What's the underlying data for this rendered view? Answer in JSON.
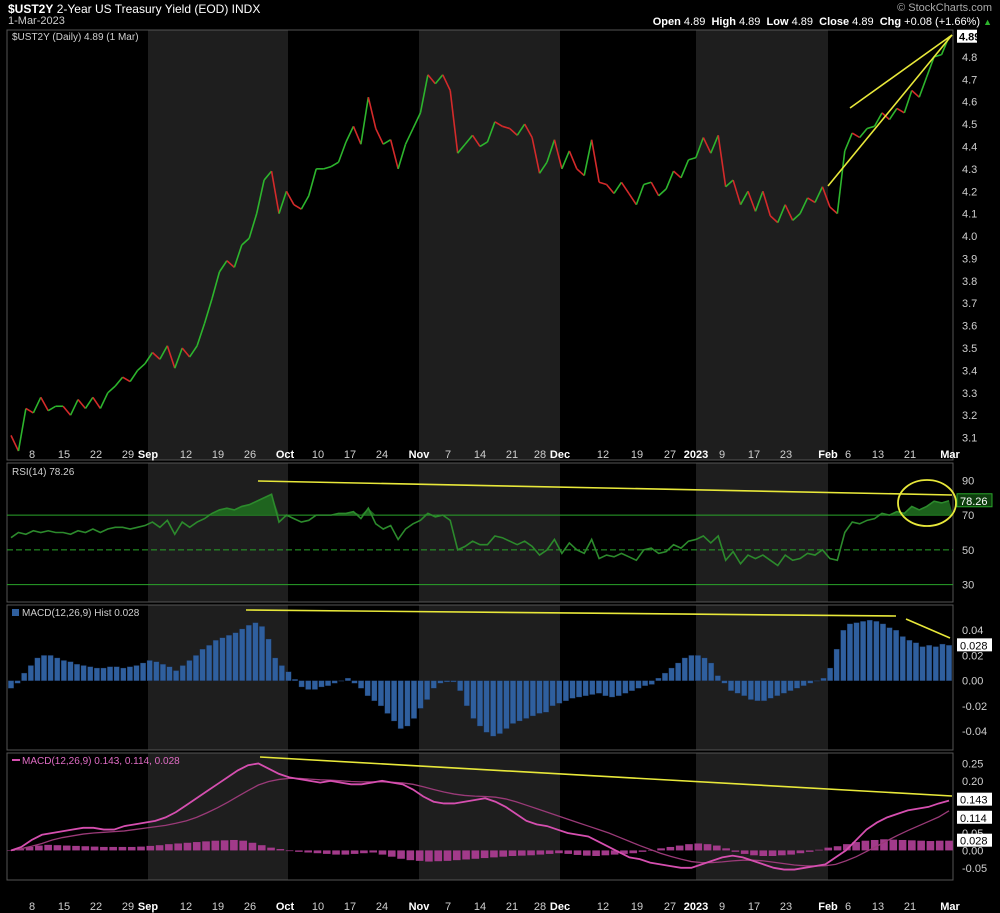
{
  "header": {
    "symbol": "$UST2Y",
    "name": "2-Year US Treasury Yield (EOD)",
    "exchange": "INDX",
    "date": "1-Mar-2023",
    "brand": "© StockCharts.com",
    "open_label": "Open",
    "open": "4.89",
    "high_label": "High",
    "high": "4.89",
    "low_label": "Low",
    "low": "4.89",
    "close_label": "Close",
    "close": "4.89",
    "chg_label": "Chg",
    "chg": "+0.08 (+1.66%)"
  },
  "colors": {
    "up": "#2db52d",
    "down": "#d42a2a",
    "band_dark": "#000000",
    "band_light": "#1e1e1e",
    "annotation": "#e8e83a",
    "rsi_line": "#2c8a2c",
    "rsi_fill": "#1f6b1f",
    "macd_hist": "#2f5f9e",
    "macd_line": "#d64fb0",
    "macd_signal": "#9a3a78",
    "macd_hist2": "#a23a8a"
  },
  "x_axis": {
    "labels": [
      "8",
      "15",
      "22",
      "29",
      "Sep",
      "12",
      "19",
      "26",
      "Oct",
      "10",
      "17",
      "24",
      "Nov",
      "7",
      "14",
      "21",
      "28",
      "Dec",
      "12",
      "19",
      "27",
      "2023",
      "9",
      "17",
      "23",
      "Feb",
      "6",
      "13",
      "21",
      "Mar"
    ],
    "bold": [
      "Sep",
      "Oct",
      "Nov",
      "Dec",
      "2023",
      "Feb",
      "Mar"
    ]
  },
  "chart_data": [
    {
      "type": "line",
      "title": "$UST2Y (Daily) 4.89 (1 Mar)",
      "y_ticks": [
        "3.1",
        "3.2",
        "3.3",
        "3.4",
        "3.5",
        "3.6",
        "3.7",
        "3.8",
        "3.9",
        "4.0",
        "4.1",
        "4.2",
        "4.3",
        "4.4",
        "4.5",
        "4.6",
        "4.7",
        "4.8"
      ],
      "ylim": [
        3.0,
        4.92
      ],
      "last_label": "4.89",
      "values": [
        3.11,
        3.04,
        3.23,
        3.21,
        3.28,
        3.22,
        3.24,
        3.24,
        3.2,
        3.27,
        3.23,
        3.28,
        3.23,
        3.3,
        3.33,
        3.37,
        3.35,
        3.4,
        3.43,
        3.48,
        3.45,
        3.51,
        3.41,
        3.5,
        3.46,
        3.51,
        3.61,
        3.72,
        3.84,
        3.89,
        3.86,
        3.96,
        3.99,
        4.1,
        4.25,
        4.29,
        4.1,
        4.2,
        4.14,
        4.12,
        4.18,
        4.3,
        4.3,
        4.31,
        4.33,
        4.42,
        4.49,
        4.41,
        4.62,
        4.48,
        4.41,
        4.43,
        4.3,
        4.41,
        4.48,
        4.55,
        4.72,
        4.68,
        4.72,
        4.65,
        4.37,
        4.41,
        4.45,
        4.4,
        4.42,
        4.51,
        4.49,
        4.48,
        4.45,
        4.5,
        4.44,
        4.28,
        4.33,
        4.43,
        4.3,
        4.38,
        4.3,
        4.27,
        4.43,
        4.24,
        4.23,
        4.19,
        4.24,
        4.19,
        4.14,
        4.23,
        4.24,
        4.18,
        4.21,
        4.29,
        4.26,
        4.34,
        4.35,
        4.44,
        4.37,
        4.45,
        4.22,
        4.25,
        4.14,
        4.2,
        4.11,
        4.2,
        4.09,
        4.06,
        4.14,
        4.07,
        4.1,
        4.17,
        4.15,
        4.22,
        4.13,
        4.1,
        4.38,
        4.46,
        4.44,
        4.48,
        4.49,
        4.55,
        4.52,
        4.57,
        4.55,
        4.65,
        4.62,
        4.71,
        4.8,
        4.81,
        4.89
      ]
    },
    {
      "type": "line",
      "title": "RSI(14) 78.26",
      "y_ticks": [
        "30",
        "50",
        "70",
        "90"
      ],
      "ylim": [
        20,
        100
      ],
      "last_label": "78.26",
      "values": [
        57,
        60,
        59,
        61,
        60,
        61,
        60,
        60,
        59,
        61,
        60,
        62,
        60,
        62,
        63,
        63,
        62,
        63,
        64,
        66,
        63,
        67,
        59,
        66,
        63,
        66,
        68,
        71,
        73,
        74,
        73,
        75,
        76,
        78,
        80,
        82,
        66,
        70,
        68,
        66,
        67,
        70,
        70,
        70,
        71,
        71,
        72,
        68,
        74,
        65,
        62,
        64,
        56,
        62,
        65,
        67,
        71,
        69,
        70,
        67,
        50,
        52,
        55,
        53,
        53,
        58,
        57,
        55,
        53,
        55,
        52,
        47,
        50,
        56,
        48,
        54,
        50,
        48,
        56,
        45,
        47,
        46,
        48,
        46,
        44,
        50,
        51,
        48,
        49,
        53,
        51,
        55,
        56,
        58,
        54,
        58,
        44,
        49,
        42,
        47,
        45,
        47,
        44,
        41,
        47,
        44,
        45,
        48,
        47,
        50,
        45,
        44,
        60,
        66,
        65,
        67,
        68,
        71,
        70,
        72,
        71,
        75,
        73,
        75,
        78,
        77,
        78.26
      ]
    },
    {
      "type": "bar",
      "title": "MACD(12,26,9) Hist 0.028",
      "y_ticks": [
        "-0.04",
        "-0.02",
        "0.00",
        "0.02",
        "0.04"
      ],
      "ylim": [
        -0.055,
        0.06
      ],
      "last_label": "0.028",
      "values": [
        -0.006,
        -0.002,
        0.006,
        0.012,
        0.018,
        0.02,
        0.02,
        0.018,
        0.016,
        0.015,
        0.013,
        0.012,
        0.011,
        0.01,
        0.01,
        0.011,
        0.011,
        0.01,
        0.011,
        0.012,
        0.014,
        0.016,
        0.015,
        0.013,
        0.011,
        0.008,
        0.012,
        0.016,
        0.02,
        0.025,
        0.028,
        0.032,
        0.034,
        0.036,
        0.038,
        0.041,
        0.044,
        0.046,
        0.043,
        0.033,
        0.018,
        0.012,
        0.007,
        0.001,
        -0.005,
        -0.007,
        -0.007,
        -0.005,
        -0.004,
        -0.002,
        0.0,
        0.002,
        -0.002,
        -0.006,
        -0.012,
        -0.016,
        -0.02,
        -0.026,
        -0.032,
        -0.038,
        -0.036,
        -0.03,
        -0.022,
        -0.015,
        -0.006,
        -0.002,
        -0.001,
        -0.001,
        -0.008,
        -0.02,
        -0.03,
        -0.036,
        -0.041,
        -0.044,
        -0.042,
        -0.038,
        -0.034,
        -0.032,
        -0.03,
        -0.028,
        -0.026,
        -0.025,
        -0.02,
        -0.018,
        -0.016,
        -0.014,
        -0.013,
        -0.012,
        -0.011,
        -0.01,
        -0.012,
        -0.013,
        -0.012,
        -0.01,
        -0.008,
        -0.006,
        -0.004,
        -0.003,
        0.002,
        0.006,
        0.01,
        0.014,
        0.018,
        0.02,
        0.02,
        0.018,
        0.014,
        0.004,
        -0.002,
        -0.008,
        -0.01,
        -0.012,
        -0.015,
        -0.016,
        -0.016,
        -0.014,
        -0.012,
        -0.01,
        -0.008,
        -0.006,
        -0.004,
        -0.002,
        0.0,
        0.002,
        0.01,
        0.025,
        0.04,
        0.045,
        0.046,
        0.047,
        0.048,
        0.047,
        0.045,
        0.042,
        0.04,
        0.035,
        0.032,
        0.03,
        0.027,
        0.028,
        0.027,
        0.029,
        0.028
      ]
    },
    {
      "type": "line",
      "title": "MACD(12,26,9) 0.143, 0.114, 0.028",
      "y_ticks": [
        "-0.05",
        "0.00",
        "0.05",
        "0.10",
        "0.15",
        "0.20",
        "0.25"
      ],
      "ylim": [
        -0.085,
        0.28
      ],
      "last_labels": [
        "0.143",
        "0.114",
        "0.028"
      ],
      "macd": [
        0.0,
        0.01,
        0.03,
        0.045,
        0.05,
        0.055,
        0.06,
        0.065,
        0.065,
        0.06,
        0.06,
        0.07,
        0.075,
        0.08,
        0.085,
        0.095,
        0.11,
        0.13,
        0.15,
        0.17,
        0.19,
        0.21,
        0.23,
        0.245,
        0.25,
        0.235,
        0.22,
        0.21,
        0.205,
        0.2,
        0.195,
        0.2,
        0.195,
        0.19,
        0.19,
        0.195,
        0.2,
        0.195,
        0.19,
        0.175,
        0.155,
        0.14,
        0.135,
        0.135,
        0.14,
        0.145,
        0.15,
        0.14,
        0.125,
        0.105,
        0.085,
        0.075,
        0.07,
        0.06,
        0.05,
        0.045,
        0.04,
        0.025,
        0.01,
        -0.005,
        -0.02,
        -0.025,
        -0.035,
        -0.04,
        -0.045,
        -0.05,
        -0.05,
        -0.04,
        -0.03,
        -0.02,
        -0.015,
        -0.02,
        -0.03,
        -0.04,
        -0.05,
        -0.055,
        -0.055,
        -0.05,
        -0.045,
        -0.04,
        -0.02,
        0.0,
        0.03,
        0.06,
        0.08,
        0.095,
        0.105,
        0.115,
        0.12,
        0.125,
        0.135,
        0.143
      ],
      "signal": [
        0.0,
        0.005,
        0.012,
        0.02,
        0.03,
        0.037,
        0.042,
        0.047,
        0.05,
        0.052,
        0.054,
        0.056,
        0.06,
        0.064,
        0.068,
        0.072,
        0.078,
        0.085,
        0.095,
        0.108,
        0.122,
        0.138,
        0.155,
        0.172,
        0.188,
        0.198,
        0.204,
        0.207,
        0.207,
        0.205,
        0.203,
        0.202,
        0.2,
        0.198,
        0.197,
        0.197,
        0.197,
        0.196,
        0.194,
        0.19,
        0.183,
        0.175,
        0.168,
        0.162,
        0.158,
        0.156,
        0.155,
        0.153,
        0.148,
        0.14,
        0.13,
        0.12,
        0.11,
        0.1,
        0.09,
        0.08,
        0.07,
        0.06,
        0.05,
        0.038,
        0.026,
        0.014,
        0.003,
        -0.008,
        -0.017,
        -0.025,
        -0.032,
        -0.035,
        -0.035,
        -0.033,
        -0.03,
        -0.028,
        -0.028,
        -0.03,
        -0.034,
        -0.038,
        -0.042,
        -0.044,
        -0.045,
        -0.044,
        -0.04,
        -0.03,
        -0.018,
        -0.003,
        0.012,
        0.028,
        0.043,
        0.057,
        0.07,
        0.083,
        0.096,
        0.114
      ],
      "hist": [
        0.0,
        0.004,
        0.01,
        0.014,
        0.016,
        0.015,
        0.014,
        0.013,
        0.012,
        0.011,
        0.01,
        0.01,
        0.01,
        0.01,
        0.011,
        0.013,
        0.015,
        0.018,
        0.02,
        0.022,
        0.024,
        0.026,
        0.028,
        0.029,
        0.03,
        0.028,
        0.022,
        0.015,
        0.008,
        0.004,
        -0.002,
        -0.004,
        -0.006,
        -0.008,
        -0.01,
        -0.012,
        -0.012,
        -0.01,
        -0.008,
        -0.006,
        -0.012,
        -0.018,
        -0.024,
        -0.028,
        -0.03,
        -0.032,
        -0.031,
        -0.03,
        -0.028,
        -0.026,
        -0.024,
        -0.022,
        -0.02,
        -0.018,
        -0.016,
        -0.015,
        -0.014,
        -0.012,
        -0.01,
        -0.008,
        -0.01,
        -0.013,
        -0.015,
        -0.016,
        -0.014,
        -0.012,
        -0.01,
        -0.008,
        -0.004,
        0.0,
        0.006,
        0.01,
        0.014,
        0.018,
        0.02,
        0.018,
        0.014,
        0.006,
        -0.004,
        -0.01,
        -0.014,
        -0.016,
        -0.016,
        -0.014,
        -0.012,
        -0.008,
        -0.004,
        0.002,
        0.008,
        0.012,
        0.018,
        0.024,
        0.028,
        0.03,
        0.032,
        0.031,
        0.03,
        0.029,
        0.028,
        0.027,
        0.028,
        0.028
      ]
    }
  ]
}
